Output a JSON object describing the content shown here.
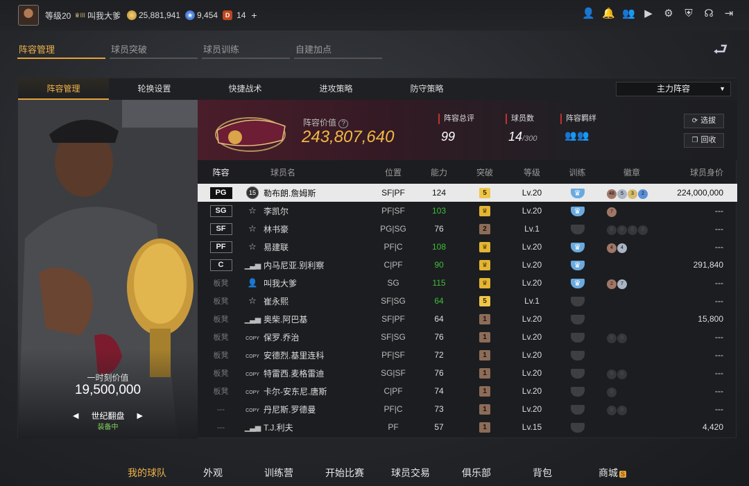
{
  "topbar": {
    "level": "等级20",
    "rank": "III",
    "username": "叫我大爹",
    "gold": "25,881,941",
    "tickets": "9,454",
    "diamonds": "14",
    "plus": "+",
    "icons": [
      "user-icon",
      "bell-icon",
      "friends-icon",
      "video-icon",
      "gear-icon",
      "shield-icon",
      "headset-icon",
      "exit-icon"
    ]
  },
  "main_tabs": [
    "阵容管理",
    "球员突破",
    "球员训练",
    "自建加点"
  ],
  "sub_tabs": [
    "阵容管理",
    "轮换设置",
    "快捷战术",
    "进攻策略",
    "防守策略"
  ],
  "lineup_select": "主力阵容",
  "player_card": {
    "value_label": "一时刻价值",
    "value": "19,500,000",
    "name": "世纪翻盘",
    "equip": "装备中"
  },
  "team": {
    "value_label": "阵容价值",
    "value": "243,807,640",
    "rating_label": "阵容总评",
    "rating": "99",
    "count_label": "球员数",
    "count": "14",
    "count_max": "/300",
    "bond_label": "阵容羁绊",
    "btn_pick": "选拔",
    "btn_recycle": "回收"
  },
  "table": {
    "headers": [
      "阵容",
      "球员名",
      "位置",
      "能力",
      "突破",
      "等级",
      "训练",
      "徽章",
      "球员身价"
    ],
    "rows": [
      {
        "pos": "PG",
        "icon": "jersey",
        "jersey": "15",
        "name": "勒布朗.詹姆斯",
        "role": "SF|PF",
        "ability": "124",
        "ab_green": false,
        "brk": "5",
        "brk_type": "gold",
        "level": "Lv.20",
        "train": "blue",
        "badges": [
          [
            "48",
            "b-bronze"
          ],
          [
            "5",
            "b-silver"
          ],
          [
            "3",
            "b-gold"
          ],
          [
            "2",
            "b-blue"
          ]
        ],
        "value": "224,000,000",
        "selected": true
      },
      {
        "pos": "SG",
        "icon": "star",
        "name": "李凯尔",
        "role": "PF|SF",
        "ability": "103",
        "ab_green": true,
        "brk": "♛",
        "brk_type": "crown",
        "level": "Lv.20",
        "train": "blue",
        "badges": [
          [
            "7",
            "b-bronze"
          ]
        ],
        "value": "---"
      },
      {
        "pos": "SF",
        "icon": "star",
        "name": "林书豪",
        "role": "PG|SG",
        "ability": "76",
        "ab_green": false,
        "brk": "2",
        "brk_type": "bronze",
        "level": "Lv.1",
        "train": "grey",
        "badges": [
          [
            "0",
            "b-dim"
          ],
          [
            "0",
            "b-dim"
          ],
          [
            "0",
            "b-dim"
          ],
          [
            "0",
            "b-dim"
          ]
        ],
        "value": "---"
      },
      {
        "pos": "PF",
        "icon": "star",
        "name": "易建联",
        "role": "PF|C",
        "ability": "108",
        "ab_green": true,
        "brk": "♛",
        "brk_type": "crown",
        "level": "Lv.20",
        "train": "blue",
        "badges": [
          [
            "4",
            "b-bronze"
          ],
          [
            "4",
            "b-silver"
          ]
        ],
        "value": "---"
      },
      {
        "pos": "C",
        "icon": "bar",
        "name": "内马尼亚.别利察",
        "role": "C|PF",
        "ability": "90",
        "ab_green": true,
        "brk": "♛",
        "brk_type": "crown",
        "level": "Lv.20",
        "train": "blue",
        "badges": [],
        "value": "291,840"
      },
      {
        "pos": "板凳",
        "icon": "user",
        "name": "叫我大爹",
        "role": "SG",
        "ability": "115",
        "ab_green": true,
        "brk": "♛",
        "brk_type": "crown",
        "level": "Lv.20",
        "train": "blue",
        "badges": [
          [
            "2",
            "b-bronze"
          ],
          [
            "7",
            "b-silver"
          ]
        ],
        "value": "---"
      },
      {
        "pos": "板凳",
        "icon": "star",
        "name": "崔永熙",
        "role": "SF|SG",
        "ability": "64",
        "ab_green": true,
        "brk": "5",
        "brk_type": "gold",
        "level": "Lv.1",
        "train": "grey",
        "badges": [],
        "value": "---"
      },
      {
        "pos": "板凳",
        "icon": "bar",
        "name": "奥柴.阿巴基",
        "role": "SF|PF",
        "ability": "64",
        "ab_green": false,
        "brk": "1",
        "brk_type": "bronze",
        "level": "Lv.20",
        "train": "grey",
        "badges": [],
        "value": "15,800"
      },
      {
        "pos": "板凳",
        "icon": "copy",
        "name": "保罗.乔治",
        "role": "SF|SG",
        "ability": "76",
        "ab_green": false,
        "brk": "1",
        "brk_type": "bronze",
        "level": "Lv.20",
        "train": "grey",
        "badges": [
          [
            "0",
            "b-dim"
          ],
          [
            "0",
            "b-dim"
          ]
        ],
        "value": "---"
      },
      {
        "pos": "板凳",
        "icon": "copy",
        "name": "安德烈.基里连科",
        "role": "PF|SF",
        "ability": "72",
        "ab_green": false,
        "brk": "1",
        "brk_type": "bronze",
        "level": "Lv.20",
        "train": "grey",
        "badges": [],
        "value": "---"
      },
      {
        "pos": "板凳",
        "icon": "copy",
        "name": "特雷西.麦格雷迪",
        "role": "SG|SF",
        "ability": "76",
        "ab_green": false,
        "brk": "1",
        "brk_type": "bronze",
        "level": "Lv.20",
        "train": "grey",
        "badges": [
          [
            "0",
            "b-dim"
          ],
          [
            "0",
            "b-dim"
          ]
        ],
        "value": "---"
      },
      {
        "pos": "板凳",
        "icon": "copy",
        "name": "卡尔-安东尼.唐斯",
        "role": "C|PF",
        "ability": "74",
        "ab_green": false,
        "brk": "1",
        "brk_type": "bronze",
        "level": "Lv.20",
        "train": "grey",
        "badges": [
          [
            "0",
            "b-dim"
          ]
        ],
        "value": "---"
      },
      {
        "pos": "---",
        "icon": "copy",
        "name": "丹尼斯.罗德曼",
        "role": "PF|C",
        "ability": "73",
        "ab_green": false,
        "brk": "1",
        "brk_type": "bronze",
        "level": "Lv.20",
        "train": "grey",
        "badges": [
          [
            "0",
            "b-dim"
          ],
          [
            "0",
            "b-dim"
          ]
        ],
        "value": "---"
      },
      {
        "pos": "---",
        "icon": "bar",
        "name": "T.J.利夫",
        "role": "PF",
        "ability": "57",
        "ab_green": false,
        "brk": "1",
        "brk_type": "bronze",
        "level": "Lv.15",
        "train": "grey",
        "badges": [],
        "value": "4,420"
      }
    ]
  },
  "bottom_nav": [
    "我的球队",
    "外观",
    "训练营",
    "开始比赛",
    "球员交易",
    "俱乐部",
    "背包",
    "商城"
  ],
  "shop_badge": "S"
}
